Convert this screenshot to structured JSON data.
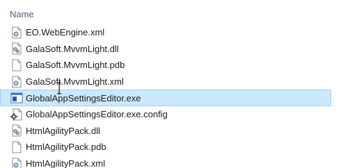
{
  "header": {
    "name_label": "Name"
  },
  "files": [
    {
      "name": "EO.WebEngine.xml",
      "icon": "xml-file-icon"
    },
    {
      "name": "GalaSoft.MvvmLight.dll",
      "icon": "dll-file-icon"
    },
    {
      "name": "GalaSoft.MvvmLight.pdb",
      "icon": "blank-file-icon"
    },
    {
      "name": "GalaSoft.MvvmLight.xml",
      "icon": "xml-file-icon"
    },
    {
      "name": "GlobalAppSettingsEditor.exe",
      "icon": "exe-app-icon",
      "selected": true
    },
    {
      "name": "GlobalAppSettingsEditor.exe.config",
      "icon": "config-file-icon"
    },
    {
      "name": "HtmlAgilityPack.dll",
      "icon": "dll-file-icon"
    },
    {
      "name": "HtmlAgilityPack.pdb",
      "icon": "blank-file-icon"
    },
    {
      "name": "HtmlAgilityPack.xml",
      "icon": "xml-file-icon"
    }
  ],
  "colors": {
    "selection_bg": "#cce8ff",
    "selection_border": "#99d1ff",
    "header_text": "#4c6079"
  }
}
